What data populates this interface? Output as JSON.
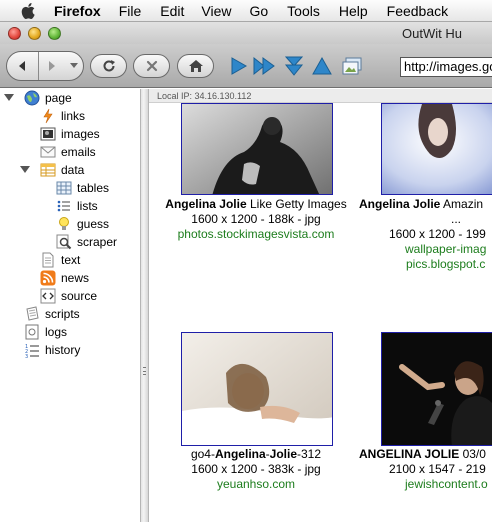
{
  "menubar": {
    "app": "Firefox",
    "items": [
      "File",
      "Edit",
      "View",
      "Go",
      "Tools",
      "Help",
      "Feedback"
    ]
  },
  "window": {
    "title": "OutWit Hu"
  },
  "toolbar": {
    "url": "http://images.go"
  },
  "sidebar": {
    "items": [
      {
        "label": "page",
        "icon": "globe-icon"
      },
      {
        "label": "links",
        "icon": "lightning-icon"
      },
      {
        "label": "images",
        "icon": "image-icon"
      },
      {
        "label": "emails",
        "icon": "envelope-icon"
      },
      {
        "label": "data",
        "icon": "table-icon"
      },
      {
        "label": "tables",
        "icon": "grid-icon"
      },
      {
        "label": "lists",
        "icon": "list-icon"
      },
      {
        "label": "guess",
        "icon": "lightbulb-icon"
      },
      {
        "label": "scraper",
        "icon": "magnifier-icon"
      },
      {
        "label": "text",
        "icon": "text-page-icon"
      },
      {
        "label": "news",
        "icon": "rss-icon"
      },
      {
        "label": "source",
        "icon": "code-icon"
      },
      {
        "label": "scripts",
        "icon": "scroll-icon"
      },
      {
        "label": "logs",
        "icon": "log-icon"
      },
      {
        "label": "history",
        "icon": "numbered-list-icon"
      }
    ]
  },
  "main": {
    "local_ip": "Local IP: 34.16.130.112",
    "results": [
      {
        "title_bold": "Angelina Jolie",
        "title_rest": " Like Getty Images",
        "meta": "1600 x 1200 - 188k - jpg",
        "source": "photos.stockimagesvista.com"
      },
      {
        "title_bold": "Angelina Jolie",
        "title_rest": " Amazin",
        "title_line2": "...",
        "meta": "1600 x 1200 - 199",
        "source": "wallpaper-imag",
        "source2": "pics.blogspot.c"
      },
      {
        "title_pre": "go4-",
        "title_bold": "Angelina",
        "title_mid": "-",
        "title_bold2": "Jolie",
        "title_rest": "-312",
        "meta": "1600 x 1200 - 383k - jpg",
        "source": "yeuanhso.com"
      },
      {
        "title_bold": "ANGELINA JOLIE",
        "title_rest": " 03/0",
        "meta": "2100 x 1547 - 219",
        "source": "jewishcontent.o"
      }
    ]
  }
}
